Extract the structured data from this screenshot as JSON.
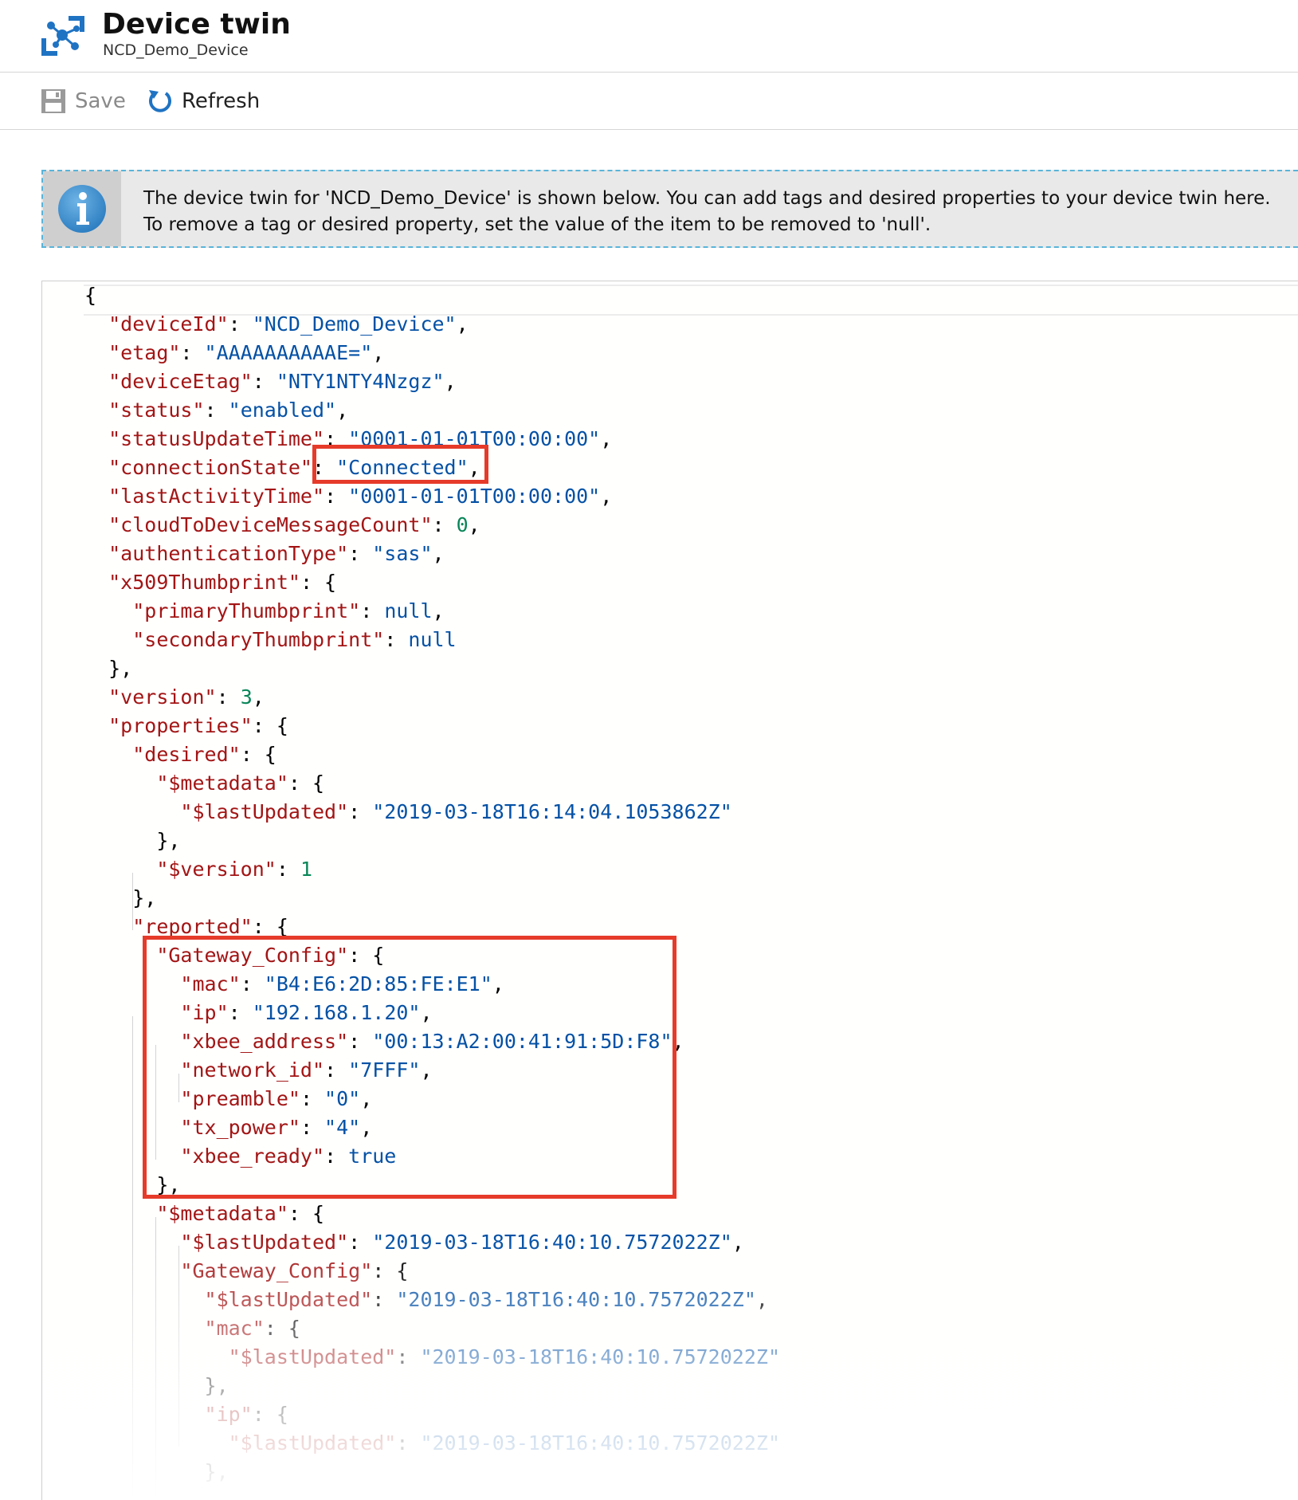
{
  "header": {
    "title": "Device twin",
    "subtitle": "NCD_Demo_Device",
    "icon": "iot-device-icon"
  },
  "toolbar": {
    "save_label": "Save",
    "refresh_label": "Refresh"
  },
  "info_banner": {
    "line1": "The device twin for 'NCD_Demo_Device' is shown below. You can add tags and desired properties to your device twin here.",
    "line2": "To remove a tag or desired property, set the value of the item to be removed to 'null'."
  },
  "colors": {
    "key": "#a31515",
    "string": "#0451a5",
    "number": "#098658",
    "highlight": "#e63b2a",
    "info_border": "#59b4d9"
  },
  "editor": {
    "lines": [
      {
        "indent": 0,
        "tokens": [
          [
            "p",
            "{"
          ]
        ]
      },
      {
        "indent": 1,
        "tokens": [
          [
            "k",
            "\"deviceId\""
          ],
          [
            "p",
            ": "
          ],
          [
            "s",
            "\"NCD_Demo_Device\""
          ],
          [
            "p",
            ","
          ]
        ]
      },
      {
        "indent": 1,
        "tokens": [
          [
            "k",
            "\"etag\""
          ],
          [
            "p",
            ": "
          ],
          [
            "s",
            "\"AAAAAAAAAAE=\""
          ],
          [
            "p",
            ","
          ]
        ]
      },
      {
        "indent": 1,
        "tokens": [
          [
            "k",
            "\"deviceEtag\""
          ],
          [
            "p",
            ": "
          ],
          [
            "s",
            "\"NTY1NTY4Nzgz\""
          ],
          [
            "p",
            ","
          ]
        ]
      },
      {
        "indent": 1,
        "tokens": [
          [
            "k",
            "\"status\""
          ],
          [
            "p",
            ": "
          ],
          [
            "s",
            "\"enabled\""
          ],
          [
            "p",
            ","
          ]
        ]
      },
      {
        "indent": 1,
        "tokens": [
          [
            "k",
            "\"statusUpdateTime\""
          ],
          [
            "p",
            ": "
          ],
          [
            "s",
            "\"0001-01-01T00:00:00\""
          ],
          [
            "p",
            ","
          ]
        ]
      },
      {
        "indent": 1,
        "tokens": [
          [
            "k",
            "\"connectionState\""
          ],
          [
            "p",
            ": "
          ],
          [
            "s",
            "\"Connected\""
          ],
          [
            "p",
            ","
          ]
        ]
      },
      {
        "indent": 1,
        "tokens": [
          [
            "k",
            "\"lastActivityTime\""
          ],
          [
            "p",
            ": "
          ],
          [
            "s",
            "\"0001-01-01T00:00:00\""
          ],
          [
            "p",
            ","
          ]
        ]
      },
      {
        "indent": 1,
        "tokens": [
          [
            "k",
            "\"cloudToDeviceMessageCount\""
          ],
          [
            "p",
            ": "
          ],
          [
            "n",
            "0"
          ],
          [
            "p",
            ","
          ]
        ]
      },
      {
        "indent": 1,
        "tokens": [
          [
            "k",
            "\"authenticationType\""
          ],
          [
            "p",
            ": "
          ],
          [
            "s",
            "\"sas\""
          ],
          [
            "p",
            ","
          ]
        ]
      },
      {
        "indent": 1,
        "tokens": [
          [
            "k",
            "\"x509Thumbprint\""
          ],
          [
            "p",
            ": {"
          ]
        ]
      },
      {
        "indent": 2,
        "tokens": [
          [
            "k",
            "\"primaryThumbprint\""
          ],
          [
            "p",
            ": "
          ],
          [
            "b",
            "null"
          ],
          [
            "p",
            ","
          ]
        ]
      },
      {
        "indent": 2,
        "tokens": [
          [
            "k",
            "\"secondaryThumbprint\""
          ],
          [
            "p",
            ": "
          ],
          [
            "b",
            "null"
          ]
        ]
      },
      {
        "indent": 1,
        "tokens": [
          [
            "p",
            "},"
          ]
        ]
      },
      {
        "indent": 1,
        "tokens": [
          [
            "k",
            "\"version\""
          ],
          [
            "p",
            ": "
          ],
          [
            "n",
            "3"
          ],
          [
            "p",
            ","
          ]
        ]
      },
      {
        "indent": 1,
        "tokens": [
          [
            "k",
            "\"properties\""
          ],
          [
            "p",
            ": {"
          ]
        ]
      },
      {
        "indent": 2,
        "tokens": [
          [
            "k",
            "\"desired\""
          ],
          [
            "p",
            ": {"
          ]
        ]
      },
      {
        "indent": 3,
        "tokens": [
          [
            "k",
            "\"$metadata\""
          ],
          [
            "p",
            ": {"
          ]
        ]
      },
      {
        "indent": 4,
        "tokens": [
          [
            "k",
            "\"$lastUpdated\""
          ],
          [
            "p",
            ": "
          ],
          [
            "s",
            "\"2019-03-18T16:14:04.1053862Z\""
          ]
        ]
      },
      {
        "indent": 3,
        "tokens": [
          [
            "p",
            "},"
          ]
        ]
      },
      {
        "indent": 3,
        "tokens": [
          [
            "k",
            "\"$version\""
          ],
          [
            "p",
            ": "
          ],
          [
            "n",
            "1"
          ]
        ]
      },
      {
        "indent": 2,
        "tokens": [
          [
            "p",
            "},"
          ]
        ]
      },
      {
        "indent": 2,
        "tokens": [
          [
            "k",
            "\"reported\""
          ],
          [
            "p",
            ": {"
          ]
        ]
      },
      {
        "indent": 3,
        "tokens": [
          [
            "k",
            "\"Gateway_Config\""
          ],
          [
            "p",
            ": {"
          ]
        ]
      },
      {
        "indent": 4,
        "tokens": [
          [
            "k",
            "\"mac\""
          ],
          [
            "p",
            ": "
          ],
          [
            "s",
            "\"B4:E6:2D:85:FE:E1\""
          ],
          [
            "p",
            ","
          ]
        ]
      },
      {
        "indent": 4,
        "tokens": [
          [
            "k",
            "\"ip\""
          ],
          [
            "p",
            ": "
          ],
          [
            "s",
            "\"192.168.1.20\""
          ],
          [
            "p",
            ","
          ]
        ]
      },
      {
        "indent": 4,
        "tokens": [
          [
            "k",
            "\"xbee_address\""
          ],
          [
            "p",
            ": "
          ],
          [
            "s",
            "\"00:13:A2:00:41:91:5D:F8\""
          ],
          [
            "p",
            ","
          ]
        ]
      },
      {
        "indent": 4,
        "tokens": [
          [
            "k",
            "\"network_id\""
          ],
          [
            "p",
            ": "
          ],
          [
            "s",
            "\"7FFF\""
          ],
          [
            "p",
            ","
          ]
        ]
      },
      {
        "indent": 4,
        "tokens": [
          [
            "k",
            "\"preamble\""
          ],
          [
            "p",
            ": "
          ],
          [
            "s",
            "\"0\""
          ],
          [
            "p",
            ","
          ]
        ]
      },
      {
        "indent": 4,
        "tokens": [
          [
            "k",
            "\"tx_power\""
          ],
          [
            "p",
            ": "
          ],
          [
            "s",
            "\"4\""
          ],
          [
            "p",
            ","
          ]
        ]
      },
      {
        "indent": 4,
        "tokens": [
          [
            "k",
            "\"xbee_ready\""
          ],
          [
            "p",
            ": "
          ],
          [
            "b",
            "true"
          ]
        ]
      },
      {
        "indent": 3,
        "tokens": [
          [
            "p",
            "},"
          ]
        ]
      },
      {
        "indent": 3,
        "tokens": [
          [
            "k",
            "\"$metadata\""
          ],
          [
            "p",
            ": {"
          ]
        ]
      },
      {
        "indent": 4,
        "tokens": [
          [
            "k",
            "\"$lastUpdated\""
          ],
          [
            "p",
            ": "
          ],
          [
            "s",
            "\"2019-03-18T16:40:10.7572022Z\""
          ],
          [
            "p",
            ","
          ]
        ]
      },
      {
        "indent": 4,
        "tokens": [
          [
            "k",
            "\"Gateway_Config\""
          ],
          [
            "p",
            ": {"
          ]
        ]
      },
      {
        "indent": 5,
        "tokens": [
          [
            "k",
            "\"$lastUpdated\""
          ],
          [
            "p",
            ": "
          ],
          [
            "s",
            "\"2019-03-18T16:40:10.7572022Z\""
          ],
          [
            "p",
            ","
          ]
        ]
      },
      {
        "indent": 5,
        "tokens": [
          [
            "k",
            "\"mac\""
          ],
          [
            "p",
            ": {"
          ]
        ]
      },
      {
        "indent": 6,
        "tokens": [
          [
            "k",
            "\"$lastUpdated\""
          ],
          [
            "p",
            ": "
          ],
          [
            "s",
            "\"2019-03-18T16:40:10.7572022Z\""
          ]
        ]
      },
      {
        "indent": 5,
        "tokens": [
          [
            "p",
            "},"
          ]
        ]
      },
      {
        "indent": 5,
        "tokens": [
          [
            "k",
            "\"ip\""
          ],
          [
            "p",
            ": {"
          ]
        ]
      },
      {
        "indent": 6,
        "tokens": [
          [
            "k",
            "\"$lastUpdated\""
          ],
          [
            "p",
            ": "
          ],
          [
            "s",
            "\"2019-03-18T16:40:10.7572022Z\""
          ]
        ]
      },
      {
        "indent": 5,
        "tokens": [
          [
            "p",
            "},"
          ]
        ]
      }
    ]
  }
}
